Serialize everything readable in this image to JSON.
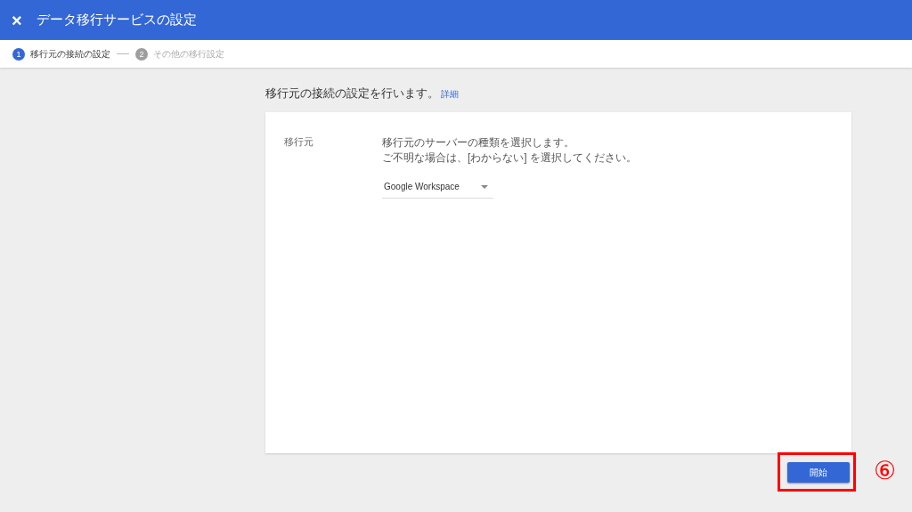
{
  "header": {
    "close": "×",
    "title": "データ移行サービスの設定"
  },
  "steps": [
    {
      "number": "1",
      "label": "移行元の接続の設定",
      "selected": true
    },
    {
      "number": "2",
      "label": "その他の移行設定",
      "selected": false
    }
  ],
  "intro": {
    "text": "移行元の接続の設定を行います。",
    "link": "詳細"
  },
  "form": {
    "label": "移行元",
    "help": [
      "移行元のサーバーの種類を選択します。",
      "ご不明な場合は、[わからない] を選択してください。"
    ],
    "select": {
      "value": "Google Workspace"
    }
  },
  "start_button": "開始",
  "annotation": {
    "number": "⑥"
  }
}
